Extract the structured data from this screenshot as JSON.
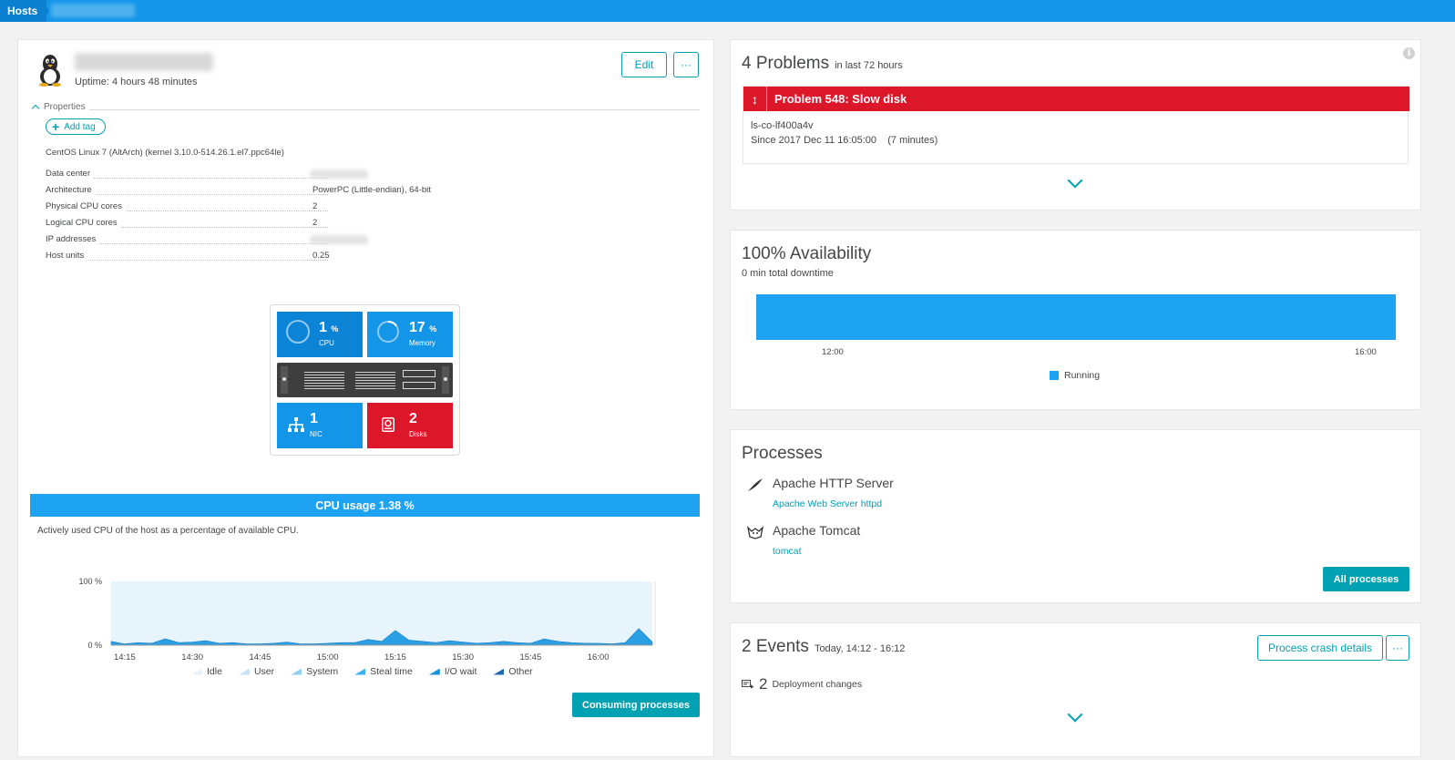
{
  "nav": {
    "breadcrumb_root": "Hosts"
  },
  "host": {
    "uptime": "Uptime: 4 hours 48 minutes",
    "edit_label": "Edit",
    "more_label": "···",
    "properties_label": "Properties",
    "add_tag_label": "Add tag",
    "os": "CentOS Linux 7 (AltArch) (kernel 3.10.0-514.26.1.el7.ppc64le)",
    "properties": [
      {
        "key": "Data center",
        "value": ""
      },
      {
        "key": "Architecture",
        "value": "PowerPC (Little-endian), 64-bit"
      },
      {
        "key": "Physical CPU cores",
        "value": "2"
      },
      {
        "key": "Logical CPU cores",
        "value": "2"
      },
      {
        "key": "IP addresses",
        "value": ""
      },
      {
        "key": "Host units",
        "value": "0.25"
      }
    ]
  },
  "infographic": {
    "cpu": {
      "value": "1",
      "unit": "%",
      "label": "CPU"
    },
    "memory": {
      "value": "17",
      "unit": "%",
      "label": "Memory"
    },
    "nic": {
      "value": "1",
      "label": "NIC"
    },
    "disks": {
      "value": "2",
      "label": "Disks"
    },
    "colors": {
      "cpu": "#0b84d6",
      "memory": "#1496e8",
      "nic": "#1496e8",
      "disks": "#dc172a"
    }
  },
  "cpu_usage": {
    "title": "CPU usage 1.38 %",
    "description": "Actively used CPU of the host as a percentage of available CPU.",
    "consuming_button": "Consuming processes"
  },
  "chart_data": {
    "type": "area",
    "ylim": [
      0,
      100
    ],
    "y_ticks": [
      "100 %",
      "0 %"
    ],
    "x_ticks": [
      "14:15",
      "14:30",
      "14:45",
      "15:00",
      "15:15",
      "15:30",
      "15:45",
      "16:00"
    ],
    "x": [
      "14:12",
      "14:15",
      "14:18",
      "14:21",
      "14:24",
      "14:27",
      "14:30",
      "14:33",
      "14:36",
      "14:39",
      "14:42",
      "14:45",
      "14:48",
      "14:51",
      "14:54",
      "14:57",
      "15:00",
      "15:03",
      "15:06",
      "15:09",
      "15:12",
      "15:15",
      "15:18",
      "15:21",
      "15:24",
      "15:27",
      "15:30",
      "15:33",
      "15:36",
      "15:39",
      "15:42",
      "15:45",
      "15:48",
      "15:51",
      "15:54",
      "15:57",
      "16:00",
      "16:03",
      "16:06",
      "16:09",
      "16:12"
    ],
    "series": [
      {
        "name": "Idle",
        "values": [
          100,
          100,
          100,
          100,
          100,
          100,
          100,
          100,
          100,
          100,
          100,
          100,
          100,
          100,
          100,
          100,
          100,
          100,
          100,
          100,
          100,
          100,
          100,
          100,
          100,
          100,
          100,
          100,
          100,
          100,
          100,
          100,
          100,
          100,
          100,
          100,
          100,
          100,
          100,
          100,
          100
        ]
      },
      {
        "name": "Other",
        "values": [
          6,
          2,
          4,
          3,
          10,
          4,
          5,
          7,
          3,
          4,
          2,
          2,
          3,
          5,
          2,
          2,
          3,
          4,
          4,
          9,
          6,
          23,
          8,
          6,
          4,
          7,
          5,
          3,
          4,
          6,
          4,
          3,
          10,
          6,
          4,
          3,
          3,
          2,
          4,
          26,
          5
        ]
      }
    ],
    "legend": [
      "Idle",
      "User",
      "System",
      "Steal time",
      "I/O wait",
      "Other"
    ],
    "legend_colors": [
      "#e8f4fb",
      "#c3e4f7",
      "#8fd0f5",
      "#3cb1ef",
      "#1b8fd9",
      "#2269b4"
    ],
    "legend_position": "bottom"
  },
  "problems": {
    "title": "4 Problems",
    "subtitle": "in last 72 hours",
    "problem_title": "Problem 548: Slow disk",
    "problem_host": "ls-co-lf400a4v",
    "problem_since": "Since 2017 Dec 11 16:05:00    (7 minutes)"
  },
  "availability": {
    "title": "100% Availability",
    "subtitle": "0 min total downtime",
    "ticks": [
      "12:00",
      "16:00"
    ],
    "legend": "Running",
    "value": 1.0,
    "color": "#1ea2f2"
  },
  "processes": {
    "title": "Processes",
    "items": [
      {
        "name": "Apache HTTP Server",
        "link": "Apache Web Server httpd"
      },
      {
        "name": "Apache Tomcat",
        "link": "tomcat"
      }
    ],
    "all_button": "All processes"
  },
  "events": {
    "title": "2 Events",
    "subtitle": "Today, 14:12 - 16:12",
    "crash_button": "Process crash details",
    "more_label": "···",
    "deploy_count": "2",
    "deploy_label": "Deployment changes"
  }
}
